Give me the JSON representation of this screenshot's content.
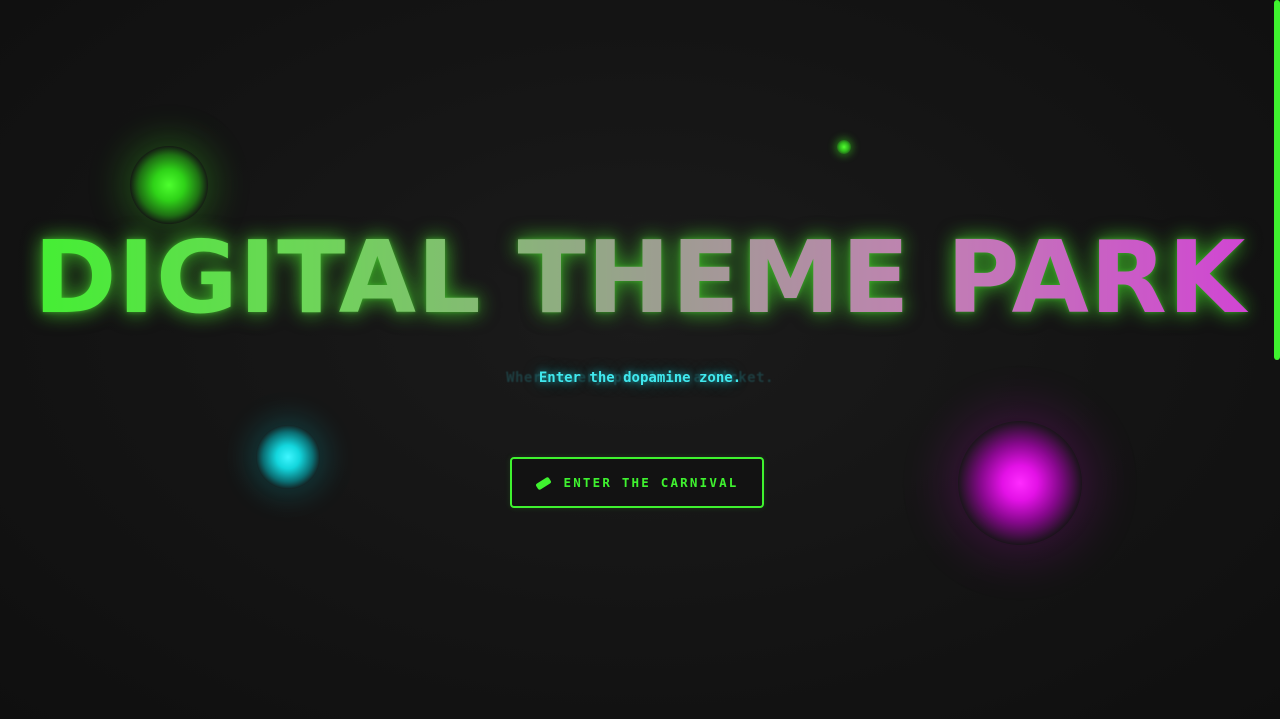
{
  "hero": {
    "title": "DIGITAL THEME PARK",
    "subtitle": "Enter the dopamine zone.",
    "subtitle_ghost": "Where every pixel is a ticket."
  },
  "cta": {
    "label": "ENTER THE CARNIVAL",
    "icon": "ticket-icon"
  },
  "scrollbar": {
    "position": 0,
    "visible_fraction": 0.5
  },
  "colors": {
    "background": "#121212",
    "neon_green": "#3ff22f",
    "neon_cyan": "#40e8ee",
    "neon_magenta": "#e311e6",
    "title_gradient": [
      "#3ff22f",
      "#9aa08e",
      "#d23fd6"
    ]
  }
}
